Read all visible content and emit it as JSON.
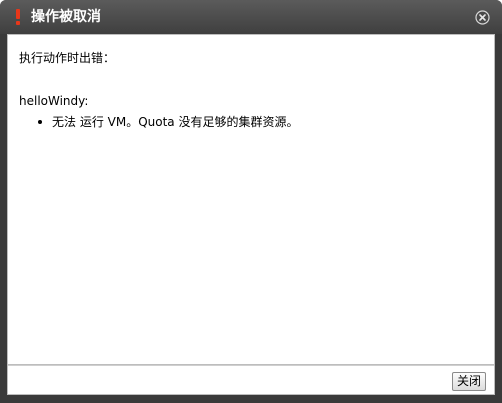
{
  "dialog": {
    "title": "操作被取消",
    "title_icon": "exclamation-icon",
    "close_icon": "close-circle-icon",
    "colors": {
      "titlebar": "#4a4a4a",
      "title_text": "#ffffff",
      "warning_icon": "#e8371a"
    }
  },
  "content": {
    "headline": "执行动作时出错：",
    "vm_name": "helloWindy:",
    "errors": [
      "无法 运行 VM。Quota 没有足够的集群资源。"
    ]
  },
  "footer": {
    "close_label": "关闭"
  }
}
